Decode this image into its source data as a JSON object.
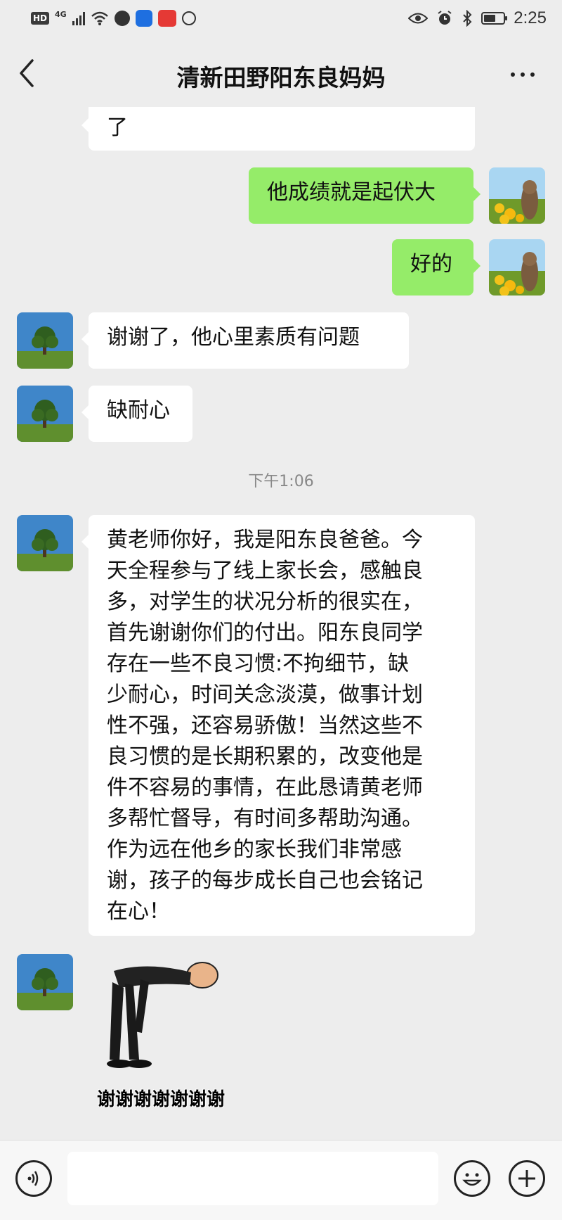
{
  "status_bar": {
    "hd": "HD",
    "network": "4G",
    "time": "2:25"
  },
  "header": {
    "title": "清新田野阳东良妈妈"
  },
  "messages": [
    {
      "side": "them",
      "text": "了"
    },
    {
      "side": "me",
      "text": "他成绩就是起伏大"
    },
    {
      "side": "me",
      "text": "好的"
    },
    {
      "side": "them",
      "text": "谢谢了，他心里素质有问题"
    },
    {
      "side": "them",
      "text": "缺耐心"
    },
    {
      "timestamp": "下午1:06"
    },
    {
      "side": "them",
      "lines": [
        "黄老师你好，我是阳东良爸爸。今",
        "天全程参与了线上家长会，感触良",
        "多，对学生的状况分析的很实在，",
        "首先谢谢你们的付出。阳东良同学",
        "存在一些不良习惯:不拘细节，缺",
        "少耐心，时间关念淡漠，做事计划",
        "性不强，还容易骄傲！当然这些不",
        "良习惯的是长期积累的，改变他是",
        "件不容易的事情，在此恳请黄老师",
        "多帮忙督导，有时间多帮助沟通。",
        "作为远在他乡的家长我们非常感",
        "谢，孩子的每步成长自己也会铭记",
        "在心！"
      ]
    },
    {
      "side": "them",
      "sticker": "bowing-man",
      "caption": "谢谢谢谢谢谢谢"
    }
  ],
  "icons": {
    "back": "chevron-left-icon",
    "more": "more-dots-icon",
    "voice": "voice-icon",
    "emoji": "emoji-icon",
    "plus": "plus-icon"
  },
  "colors": {
    "background": "#ededed",
    "my_bubble": "#95ec69",
    "their_bubble": "#ffffff",
    "timestamp": "#888888"
  }
}
